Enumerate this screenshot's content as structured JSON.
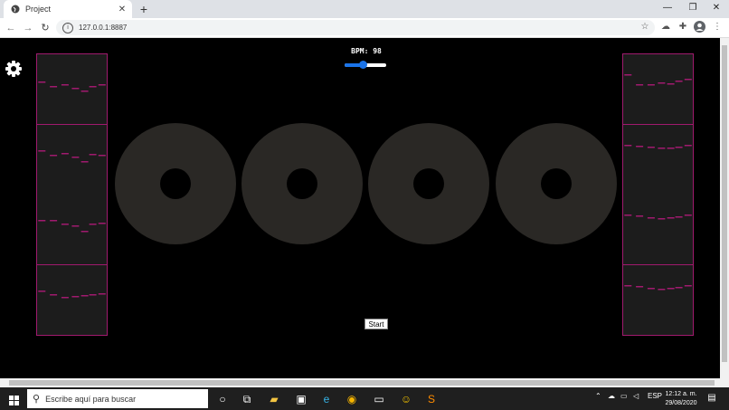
{
  "browser": {
    "tab_title": "Project",
    "tab_close": "✕",
    "new_tab": "+",
    "url": "127.0.0.1:8887",
    "window_controls": {
      "minimize": "—",
      "maximize": "❐",
      "close": "✕"
    }
  },
  "app": {
    "bpm_label": "BPM: 98",
    "bpm_value": 98,
    "bpm_slider_fraction": 0.45,
    "start_label": "Start",
    "accent_color": "#a01a6e",
    "slider_color": "#1a73e8"
  },
  "sequencer_left": [
    {
      "notes": [
        [
          2,
          30
        ],
        [
          22,
          35
        ],
        [
          42,
          33
        ],
        [
          60,
          37
        ],
        [
          76,
          40
        ],
        [
          90,
          35
        ],
        [
          106,
          33
        ]
      ]
    },
    {
      "notes": [
        [
          2,
          28
        ],
        [
          22,
          33
        ],
        [
          42,
          31
        ],
        [
          60,
          35
        ],
        [
          76,
          40
        ],
        [
          90,
          32
        ],
        [
          106,
          33
        ]
      ]
    },
    {
      "notes": [
        [
          2,
          28
        ],
        [
          22,
          28
        ],
        [
          42,
          32
        ],
        [
          60,
          34
        ],
        [
          76,
          40
        ],
        [
          90,
          32
        ],
        [
          106,
          31
        ]
      ]
    },
    {
      "notes": [
        [
          2,
          28
        ],
        [
          22,
          32
        ],
        [
          42,
          35
        ],
        [
          60,
          34
        ],
        [
          76,
          33
        ],
        [
          90,
          32
        ],
        [
          106,
          31
        ]
      ]
    }
  ],
  "sequencer_right": [
    {
      "notes": [
        [
          2,
          22
        ],
        [
          22,
          33
        ],
        [
          42,
          33
        ],
        [
          60,
          31
        ],
        [
          76,
          32
        ],
        [
          90,
          29
        ],
        [
          106,
          27
        ]
      ]
    },
    {
      "notes": [
        [
          2,
          22
        ],
        [
          22,
          23
        ],
        [
          42,
          24
        ],
        [
          60,
          25
        ],
        [
          76,
          25
        ],
        [
          90,
          24
        ],
        [
          106,
          22
        ]
      ]
    },
    {
      "notes": [
        [
          2,
          22
        ],
        [
          22,
          23
        ],
        [
          42,
          25
        ],
        [
          60,
          26
        ],
        [
          76,
          25
        ],
        [
          90,
          24
        ],
        [
          106,
          22
        ]
      ]
    },
    {
      "notes": [
        [
          2,
          22
        ],
        [
          22,
          23
        ],
        [
          42,
          25
        ],
        [
          60,
          26
        ],
        [
          76,
          25
        ],
        [
          90,
          24
        ],
        [
          106,
          22
        ]
      ]
    }
  ],
  "taskbar": {
    "search_placeholder": "Escribe aquí para buscar",
    "language": "ESP",
    "time": "12:12 a. m.",
    "date": "29/08/2020"
  }
}
